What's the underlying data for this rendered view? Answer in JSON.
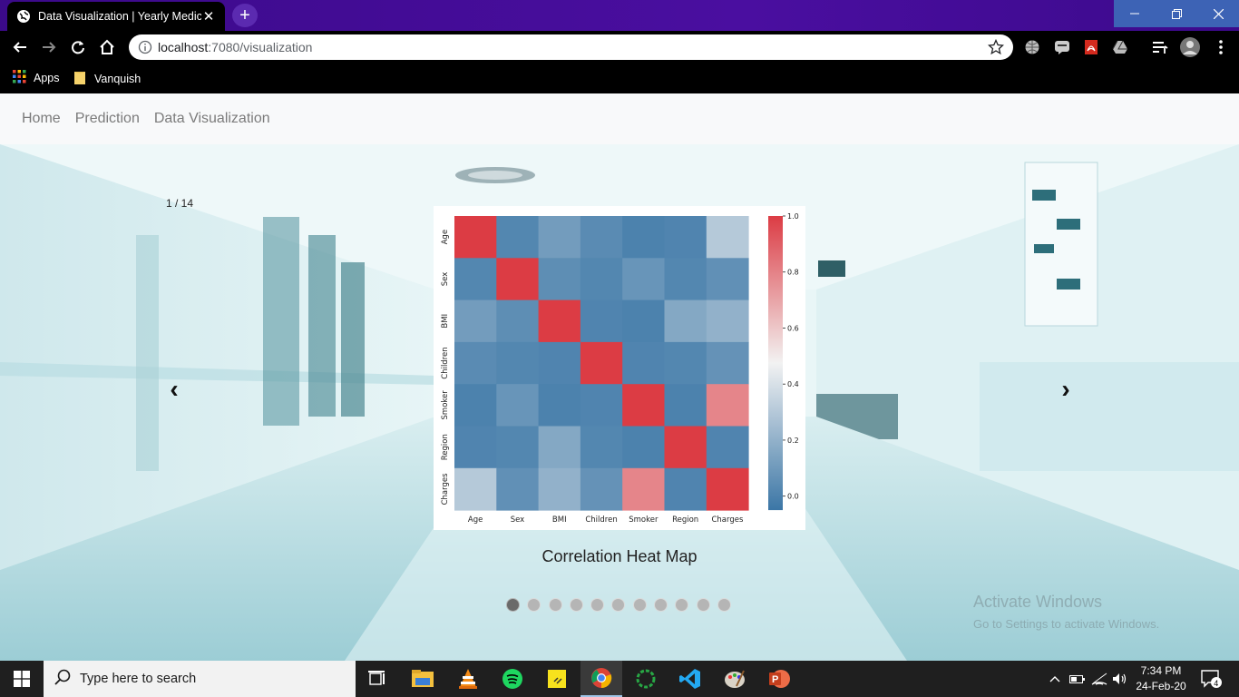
{
  "browser": {
    "tab_title": "Data Visualization | Yearly Medica",
    "url_host": "localhost",
    "url_path": ":7080/visualization",
    "bookmarks": [
      {
        "label": "Apps",
        "icon": "apps-grid-icon"
      },
      {
        "label": "Vanquish",
        "icon": "folder-icon"
      }
    ]
  },
  "navbar": {
    "links": [
      "Home",
      "Prediction",
      "Data Visualization"
    ]
  },
  "carousel": {
    "counter": "1 / 14",
    "prev_label": "‹",
    "next_label": "›",
    "caption": "Correlation Heat Map",
    "indicator_count": 11,
    "active_index": 0
  },
  "chart_data": {
    "type": "heatmap",
    "title": "",
    "x_labels": [
      "Age",
      "Sex",
      "BMI",
      "Children",
      "Smoker",
      "Region",
      "Charges"
    ],
    "y_labels": [
      "Age",
      "Sex",
      "BMI",
      "Children",
      "Smoker",
      "Region",
      "Charges"
    ],
    "values": [
      [
        1.0,
        0.02,
        0.11,
        0.04,
        0.0,
        0.01,
        0.3
      ],
      [
        0.02,
        1.0,
        0.05,
        0.02,
        0.08,
        0.02,
        0.06
      ],
      [
        0.11,
        0.05,
        1.0,
        0.01,
        0.0,
        0.16,
        0.2
      ],
      [
        0.04,
        0.02,
        0.01,
        1.0,
        0.01,
        0.02,
        0.07
      ],
      [
        0.0,
        0.08,
        0.0,
        0.01,
        1.0,
        0.0,
        0.79
      ],
      [
        0.01,
        0.02,
        0.16,
        0.02,
        0.0,
        1.0,
        0.01
      ],
      [
        0.3,
        0.06,
        0.2,
        0.07,
        0.79,
        0.01,
        1.0
      ]
    ],
    "colorbar_ticks": [
      "1.0",
      "0.8",
      "0.6",
      "0.4",
      "0.2",
      "0.0"
    ],
    "colorbar_range": [
      -0.05,
      1.0
    ],
    "colormap": {
      "low": "#3b76a6",
      "mid": "#f2f2f2",
      "high": "#dc3c44"
    }
  },
  "watermark": {
    "line1": "Activate Windows",
    "line2": "Go to Settings to activate Windows."
  },
  "taskbar": {
    "search_placeholder": "Type here to search",
    "time": "7:34 PM",
    "date": "24-Feb-20",
    "notification_count": "4"
  }
}
